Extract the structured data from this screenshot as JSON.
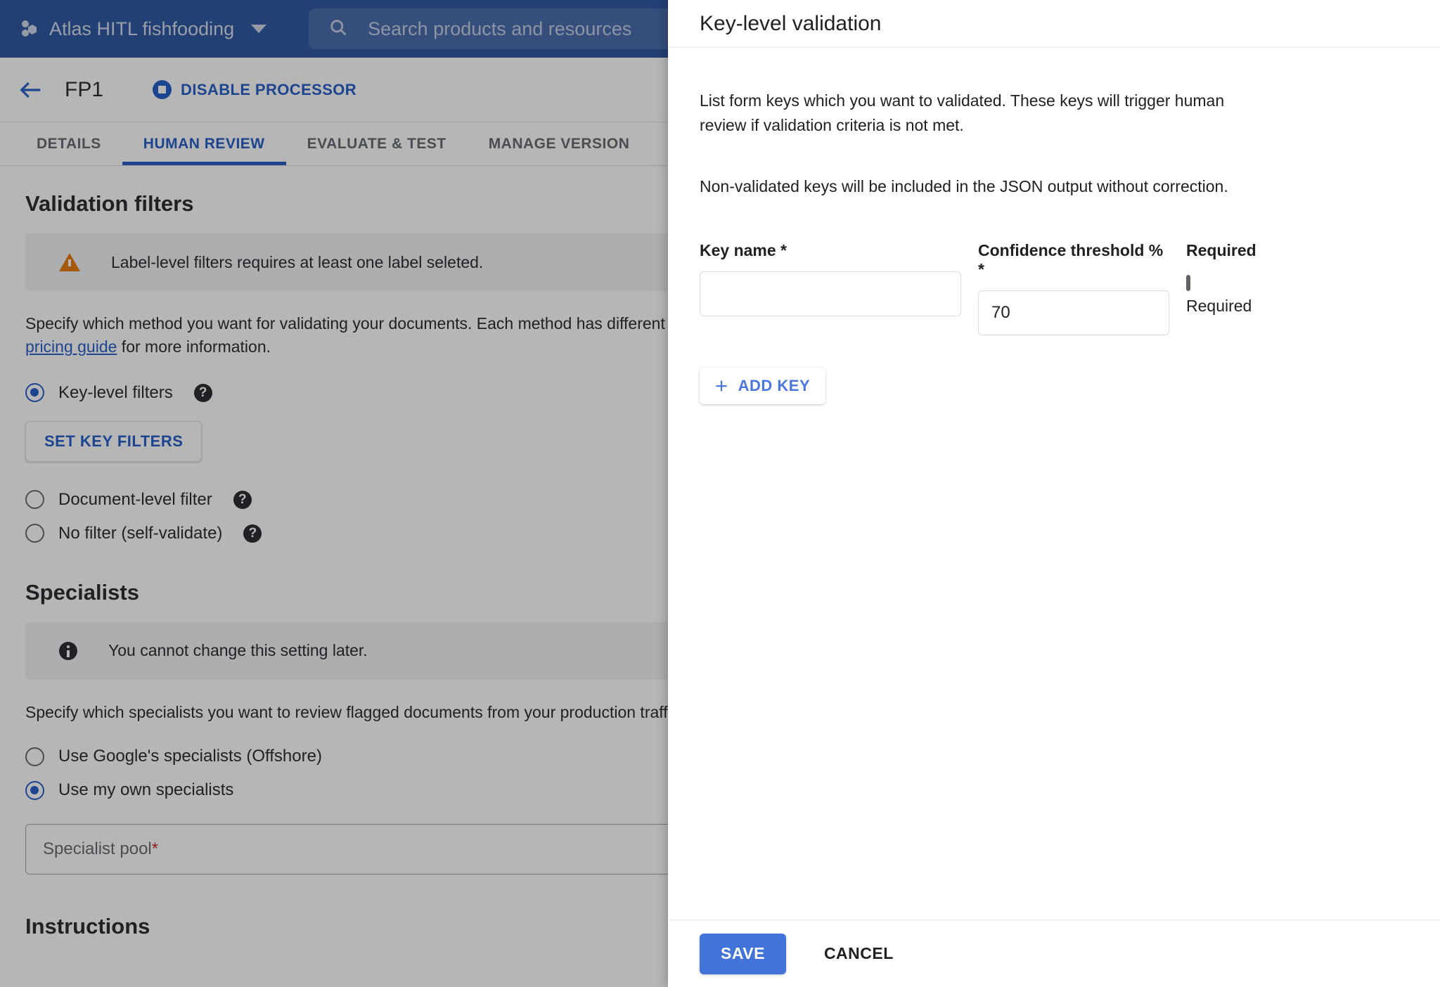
{
  "topbar": {
    "project_name": "Atlas HITL fishfooding",
    "logo_icon": "google-cloud-dots-icon",
    "project_caret_icon": "chevron-down-icon",
    "search_icon": "search-icon",
    "search_placeholder": "Search products and resources",
    "search_value": ""
  },
  "processor_bar": {
    "back_icon": "arrow-left-icon",
    "title": "FP1",
    "disable_icon": "stop-circle-icon",
    "disable_label": "DISABLE PROCESSOR"
  },
  "tabs": [
    {
      "label": "DETAILS",
      "active": false
    },
    {
      "label": "HUMAN REVIEW",
      "active": true
    },
    {
      "label": "EVALUATE & TEST",
      "active": false
    },
    {
      "label": "MANAGE VERSION",
      "active": false
    }
  ],
  "validation_filters": {
    "heading": "Validation filters",
    "warning_icon": "warning-triangle-icon",
    "warning_text": "Label-level filters requires at least one label seleted.",
    "description_part1": "Specify which method you want for validating your documents. Each method has different pricing implications. View the ",
    "description_link": "pricing guide",
    "description_part2": " for more information.",
    "options": [
      {
        "label": "Key-level filters",
        "selected": true,
        "help_icon": "help-circle-icon"
      },
      {
        "label": "Document-level filter",
        "selected": false,
        "help_icon": "help-circle-icon"
      },
      {
        "label": "No filter (self-validate)",
        "selected": false,
        "help_icon": "help-circle-icon"
      }
    ],
    "set_key_filters_label": "SET KEY FILTERS"
  },
  "specialists": {
    "heading": "Specialists",
    "info_icon": "info-circle-icon",
    "info_text": "You cannot change this setting later.",
    "description": "Specify which specialists you want to review flagged documents from your production traffic.",
    "options": [
      {
        "label": "Use Google's specialists (Offshore)",
        "selected": false
      },
      {
        "label": "Use my own specialists",
        "selected": true
      }
    ],
    "pool_label": "Specialist pool",
    "pool_required_marker": "*",
    "pool_value": "",
    "pool_caret_icon": "chevron-down-icon"
  },
  "instructions": {
    "heading": "Instructions"
  },
  "panel": {
    "title": "Key-level validation",
    "paragraph_1": "List form keys which you want to validated. These keys will trigger human review if validation criteria is not met.",
    "paragraph_2": "Non-validated keys will be included in the JSON output without correction.",
    "fields": {
      "key_name_label": "Key name *",
      "key_name_value": "",
      "key_name_placeholder": "",
      "confidence_label": "Confidence threshold % *",
      "confidence_value": "70",
      "required_header": "Required",
      "required_checkbox_label": "Required",
      "required_checked": false
    },
    "add_key_icon": "plus-icon",
    "add_key_label": "ADD KEY",
    "save_label": "SAVE",
    "cancel_label": "CANCEL"
  },
  "colors": {
    "brand_blue": "#25509b",
    "accent_blue": "#1a56c4",
    "save_blue": "#4273d8",
    "warning_orange": "#e37400",
    "required_red": "#c5221f"
  }
}
